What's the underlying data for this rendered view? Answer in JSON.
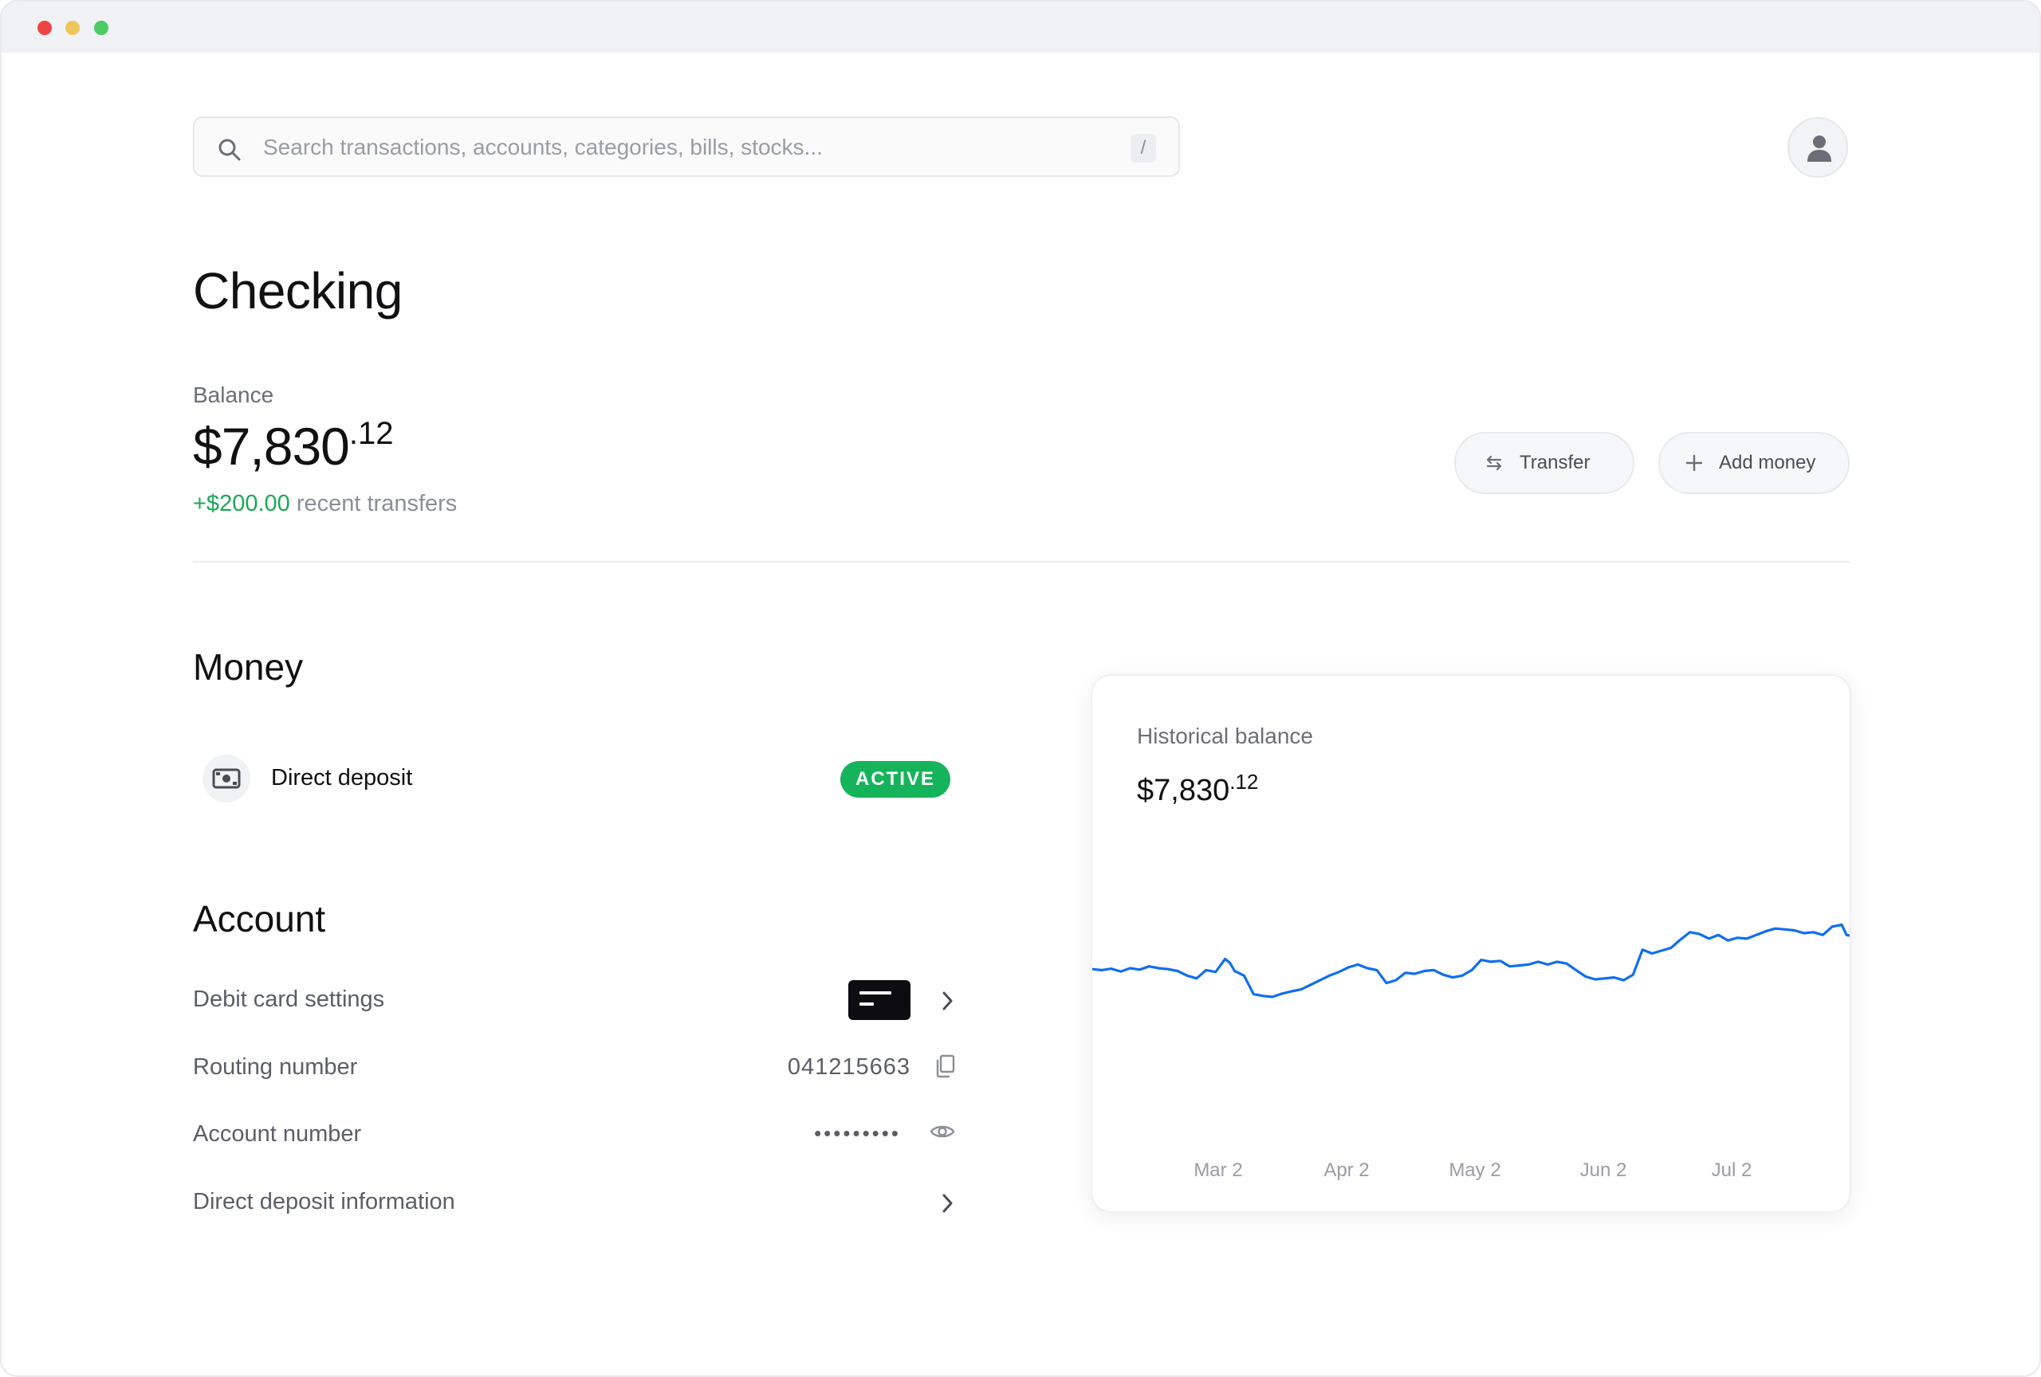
{
  "search": {
    "placeholder": "Search transactions, accounts, categories, bills, stocks...",
    "shortcut": "/"
  },
  "page": {
    "title": "Checking"
  },
  "balance": {
    "label": "Balance",
    "whole": "$7,830",
    "cents": ".12",
    "change_amount": "+$200.00",
    "change_text": "recent transfers"
  },
  "actions": {
    "transfer_label": "Transfer",
    "add_money_label": "Add money"
  },
  "money": {
    "title": "Money",
    "direct_deposit_label": "Direct deposit",
    "direct_deposit_status": "ACTIVE"
  },
  "account": {
    "title": "Account",
    "debit_card_label": "Debit card settings",
    "routing_label": "Routing number",
    "routing_value": "041215663",
    "account_label": "Account number",
    "account_value_masked": "•••••••••",
    "dd_info_label": "Direct deposit information"
  },
  "colors": {
    "accent_line": "#0f6ef0",
    "active_green": "#16b45a",
    "positive_text": "#1aaa52"
  },
  "chart": {
    "label": "Historical balance",
    "whole": "$7,830",
    "cents": ".12"
  },
  "chart_data": {
    "type": "line",
    "title": "Historical balance",
    "xlabel": "",
    "ylabel": "",
    "x_ticks": [
      "Mar 2",
      "Apr 2",
      "May 2",
      "Jun 2",
      "Jul 2"
    ],
    "x_range_days": [
      0,
      160
    ],
    "y_range": [
      6000,
      8500
    ],
    "grid": false,
    "series": [
      {
        "color": "#0f6ef0",
        "points": [
          [
            0,
            7050
          ],
          [
            2,
            7040
          ],
          [
            4,
            7055
          ],
          [
            6,
            7025
          ],
          [
            8,
            7060
          ],
          [
            10,
            7045
          ],
          [
            12,
            7080
          ],
          [
            14,
            7060
          ],
          [
            16,
            7050
          ],
          [
            18,
            7030
          ],
          [
            20,
            6980
          ],
          [
            22,
            6950
          ],
          [
            24,
            7040
          ],
          [
            26,
            7020
          ],
          [
            28,
            7160
          ],
          [
            29,
            7120
          ],
          [
            30,
            7030
          ],
          [
            32,
            6980
          ],
          [
            34,
            6780
          ],
          [
            36,
            6760
          ],
          [
            38,
            6750
          ],
          [
            40,
            6785
          ],
          [
            42,
            6810
          ],
          [
            44,
            6830
          ],
          [
            46,
            6880
          ],
          [
            48,
            6930
          ],
          [
            50,
            6980
          ],
          [
            52,
            7020
          ],
          [
            54,
            7070
          ],
          [
            56,
            7100
          ],
          [
            58,
            7060
          ],
          [
            60,
            7040
          ],
          [
            62,
            6900
          ],
          [
            64,
            6930
          ],
          [
            66,
            7010
          ],
          [
            68,
            7000
          ],
          [
            70,
            7030
          ],
          [
            72,
            7040
          ],
          [
            74,
            6990
          ],
          [
            76,
            6960
          ],
          [
            78,
            6980
          ],
          [
            80,
            7040
          ],
          [
            82,
            7150
          ],
          [
            84,
            7130
          ],
          [
            86,
            7140
          ],
          [
            88,
            7080
          ],
          [
            90,
            7090
          ],
          [
            92,
            7100
          ],
          [
            94,
            7130
          ],
          [
            96,
            7100
          ],
          [
            98,
            7130
          ],
          [
            100,
            7110
          ],
          [
            102,
            7040
          ],
          [
            104,
            6970
          ],
          [
            106,
            6940
          ],
          [
            108,
            6950
          ],
          [
            110,
            6960
          ],
          [
            112,
            6930
          ],
          [
            114,
            6990
          ],
          [
            116,
            7260
          ],
          [
            118,
            7220
          ],
          [
            120,
            7250
          ],
          [
            122,
            7280
          ],
          [
            124,
            7370
          ],
          [
            126,
            7450
          ],
          [
            128,
            7430
          ],
          [
            130,
            7380
          ],
          [
            132,
            7420
          ],
          [
            134,
            7360
          ],
          [
            136,
            7390
          ],
          [
            138,
            7380
          ],
          [
            140,
            7420
          ],
          [
            142,
            7460
          ],
          [
            144,
            7490
          ],
          [
            146,
            7480
          ],
          [
            148,
            7470
          ],
          [
            150,
            7440
          ],
          [
            152,
            7450
          ],
          [
            154,
            7420
          ],
          [
            156,
            7510
          ],
          [
            158,
            7530
          ],
          [
            159,
            7420
          ],
          [
            160,
            7410
          ]
        ]
      }
    ]
  }
}
